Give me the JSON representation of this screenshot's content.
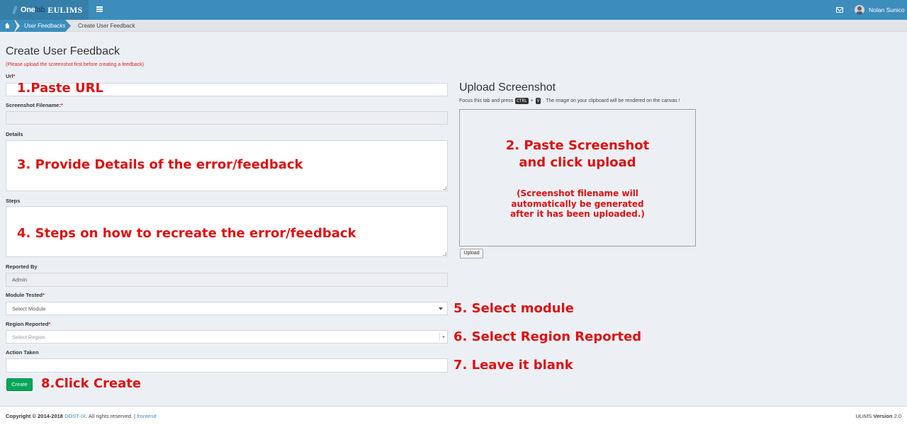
{
  "header": {
    "logo_one": "One",
    "logo_lab": "lab",
    "logo_eulims": "EULIMS",
    "user_name": "Nolan Sunico"
  },
  "breadcrumb": {
    "items": [
      "User Feedbacks",
      "Create User Feedback"
    ]
  },
  "form": {
    "title": "Create User Feedback",
    "note": "(Please upload the screenshot first before creating a feedback)",
    "url_label": "Url",
    "screenshot_label": "Screenshot Filename:",
    "details_label": "Details",
    "steps_label": "Steps",
    "reported_by_label": "Reported By",
    "reported_by_value": "Admin",
    "module_label": "Module Tested",
    "module_value": "Select Module",
    "region_label": "Region Reported",
    "region_placeholder": "Select Region",
    "action_label": "Action Taken",
    "create_label": "Create",
    "required_mark": "*"
  },
  "upload": {
    "title": "Upload Screenshot",
    "desc_before": "Focus this tab and press",
    "key_ctrl": "CTRL",
    "plus": "+",
    "key_v": "V",
    "desc_after": ". The image on your clipboard will be rendered on the canvas !",
    "button_label": "Upload"
  },
  "annotations": {
    "a1": "1.Paste URL",
    "a2_line1": "2. Paste Screenshot",
    "a2_line2": "and click upload",
    "a2_note1": "(Screenshot filename will",
    "a2_note2": "automatically be generated",
    "a2_note3": "after it has been uploaded.)",
    "a3": "3. Provide Details of the error/feedback",
    "a4": "4. Steps on how to recreate the error/feedback",
    "a5": "5. Select module",
    "a6": "6. Select Region Reported",
    "a7": "7. Leave it blank",
    "a8": "8.Click Create"
  },
  "footer": {
    "copyright": "Copyright © 2014-2018",
    "org": "DOST-IX",
    "rights": ". All rights reserved. |",
    "frontend": "frontend",
    "app": "ULIMS",
    "version_label": "Version",
    "version_value": "2.0"
  },
  "colors": {
    "header": "#3c8dbc",
    "logo_bg": "#367fa9",
    "page_bg": "#ecf0f5",
    "create_button": "#00a65a",
    "annotation_red": "#dd1111"
  }
}
